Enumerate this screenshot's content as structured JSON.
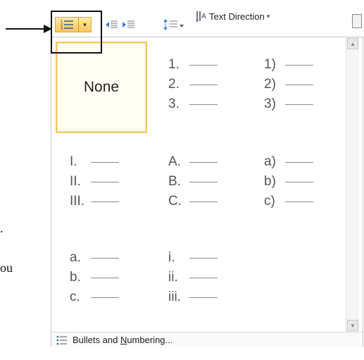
{
  "ribbon": {
    "numbering_button": {
      "icon": "numbering-icon",
      "dropdown_icon": "caret-down-icon"
    },
    "indent_icons": [
      "decrease-indent-icon",
      "increase-indent-icon"
    ],
    "line_spacing_icon": "line-spacing-icon",
    "text_direction": {
      "label": "Text Direction",
      "icon": "text-direction-icon",
      "caret": "▾"
    }
  },
  "background_doc": {
    "fragment_1": ".",
    "fragment_2": "ou"
  },
  "numbering_library": {
    "tiles": [
      {
        "type": "none",
        "label": "None",
        "selected": true
      },
      {
        "type": "list",
        "markers": [
          "1.",
          "2.",
          "3."
        ]
      },
      {
        "type": "list",
        "markers": [
          "1)",
          "2)",
          "3)"
        ]
      },
      {
        "type": "list",
        "markers": [
          "I.",
          "II.",
          "III."
        ]
      },
      {
        "type": "list",
        "markers": [
          "A.",
          "B.",
          "C."
        ]
      },
      {
        "type": "list",
        "markers": [
          "a)",
          "b)",
          "c)"
        ]
      },
      {
        "type": "list",
        "markers": [
          "a.",
          "b.",
          "c."
        ]
      },
      {
        "type": "list",
        "markers": [
          "i.",
          "ii.",
          "iii."
        ]
      }
    ]
  },
  "footer": {
    "label_before": "Bullets and ",
    "label_underlined": "N",
    "label_after": "umbering...",
    "icon": "bullets-numbering-icon"
  },
  "colors": {
    "selected_border": "#f3c85d",
    "selected_bg": "#fffdf4",
    "button_highlight": "#f7c75a"
  }
}
